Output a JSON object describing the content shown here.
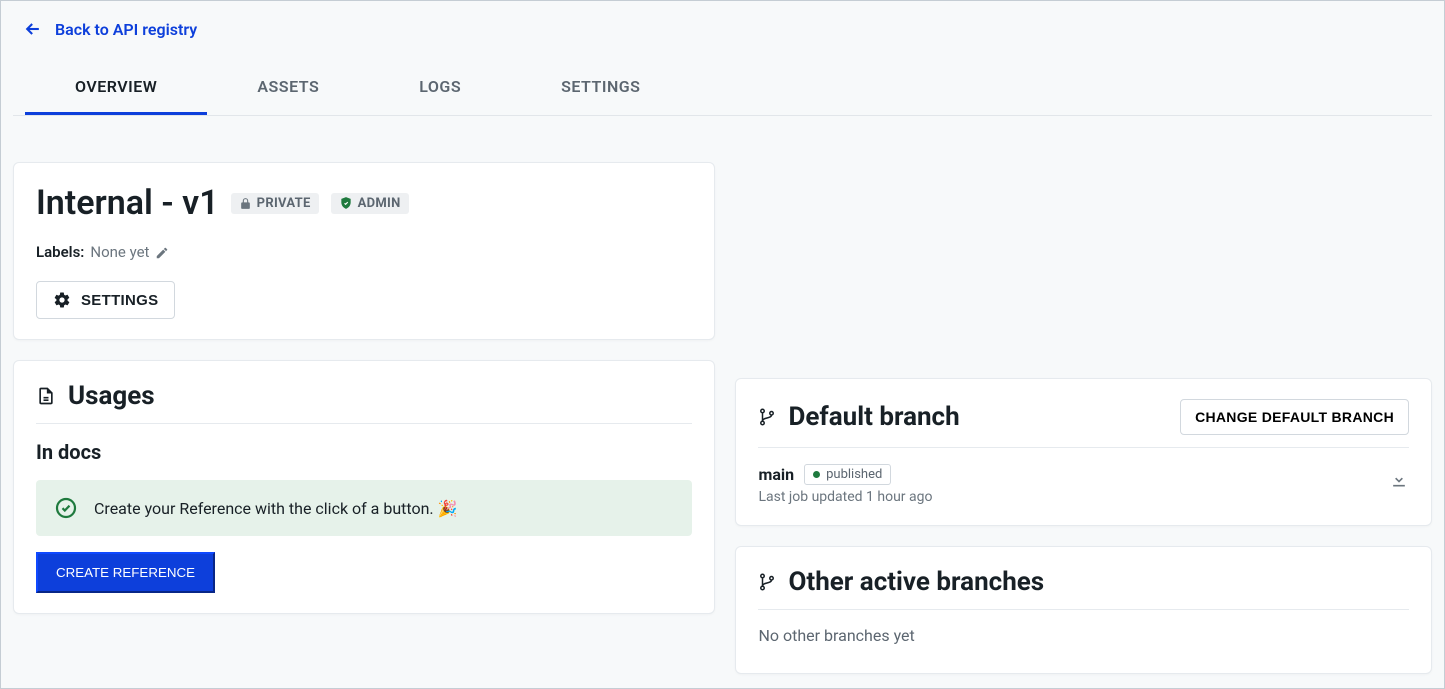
{
  "back_link": "Back to API registry",
  "tabs": {
    "overview": "OVERVIEW",
    "assets": "ASSETS",
    "logs": "LOGS",
    "settings": "SETTINGS"
  },
  "header_card": {
    "title": "Internal - v1",
    "private_badge": "PRIVATE",
    "admin_badge": "ADMIN",
    "labels_label": "Labels:",
    "labels_value": "None yet",
    "settings_button": "SETTINGS"
  },
  "usages": {
    "title": "Usages",
    "in_docs": "In docs",
    "banner_text": "Create your Reference with the click of a button.",
    "create_button": "CREATE REFERENCE"
  },
  "default_branch": {
    "title": "Default branch",
    "change_button": "CHANGE DEFAULT BRANCH",
    "name": "main",
    "status": "published",
    "meta": "Last job updated 1 hour ago"
  },
  "other_branches": {
    "title": "Other active branches",
    "empty": "No other branches yet"
  }
}
